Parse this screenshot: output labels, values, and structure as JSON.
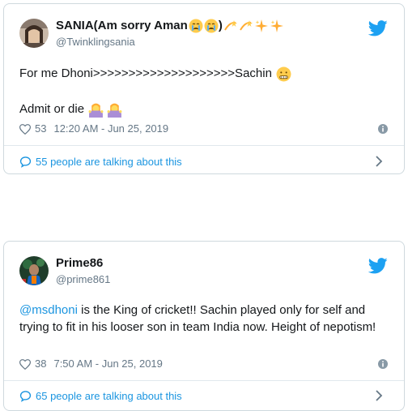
{
  "tweets": [
    {
      "display_name": "SANIA(Am sorry Aman",
      "display_name_suffix": ")",
      "handle": "@Twinklingsania",
      "text_line1": "For me Dhoni>>>>>>>>>>>>>>>>>>>>Sachin",
      "text_line2": "Admit or die",
      "likes": "53",
      "timestamp": "12:20 AM - Jun 25, 2019",
      "talking": "55 people are talking about this"
    },
    {
      "display_name": "Prime86",
      "handle": "@prime861",
      "mention": "@msdhoni",
      "text": " is the King of cricket!! Sachin played only for self and trying to fit in his looser son in team India now. Height of nepotism!",
      "likes": "38",
      "timestamp": "7:50 AM - Jun 25, 2019",
      "talking": "65 people are talking about this"
    }
  ],
  "colors": {
    "twitter_blue": "#1da1f2",
    "link_blue": "#1b95e0",
    "muted": "#657786",
    "border": "#cfd9de"
  },
  "icons": [
    "twitter-bird-icon",
    "heart-icon",
    "info-icon",
    "speech-bubble-icon",
    "chevron-right-icon"
  ]
}
